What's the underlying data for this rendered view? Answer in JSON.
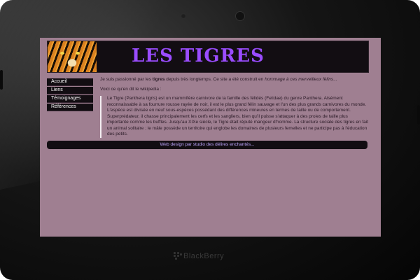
{
  "device": {
    "brand": "BlackBerry"
  },
  "banner": {
    "title": "LES TIGRES",
    "image_alt": "tiger"
  },
  "nav": {
    "items": [
      {
        "label": "Accueil"
      },
      {
        "label": "Liens"
      },
      {
        "label": "Témoignages"
      },
      {
        "label": "Références"
      }
    ]
  },
  "content": {
    "intro_a": "Je suis passionné par les ",
    "intro_bold": "tigres",
    "intro_b": " depuis très longtemps. Ce site a été construit en ",
    "intro_italic": "hommage à ces merveilleux félins",
    "intro_c": "...",
    "wiki_line": "Voici ce qu'en dit le wikipedia :",
    "quote": "Le Tigre (Panthera tigris) est un mammifère carnivore de la famille des félidés (Felidae) du genre Panthera. Aisément reconnaissable à sa fourrure rousse rayée de noir, il est le plus grand félin sauvage et l'un des plus grands carnivores du monde. L'espèce est divisée en neuf sous-espèces possédant des différences mineures en termes de taille ou de comportement. Superprédateur, il chasse principalement les cerfs et les sangliers, bien qu'il puisse s'attaquer à des proies de taille plus importante comme les buffles. Jusqu'au XIXe siècle, le Tigre était réputé mangeur d'homme. La structure sociale des tigres en fait un animal solitaire ; le mâle possède un territoire qui englobe les domaines de plusieurs femelles et ne participe pas à l'éducation des petits."
  },
  "footer": {
    "text": "Web design par studio des délires enchantés..."
  },
  "colors": {
    "page_bg": "#9f7f91",
    "banner_bg": "#120d12",
    "title": "#9a4cff",
    "footer_text": "#bfa6ff"
  }
}
